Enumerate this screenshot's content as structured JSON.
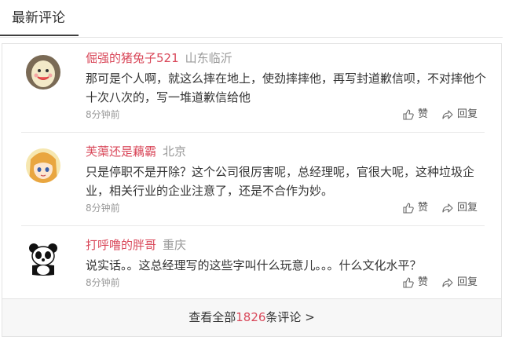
{
  "tabs": {
    "active_label": "最新评论"
  },
  "comments": [
    {
      "username": "倔强的猪兔子521",
      "location": "山东临沂",
      "text": "那可是个人啊，就这么摔在地上，使劲摔摔他，再写封道歉信呗，不对摔他个十次八次的，写一堆道歉信给他",
      "time": "8分钟前",
      "like_label": "赞",
      "reply_label": "回复",
      "avatar_icon": "smiley-egg-avatar"
    },
    {
      "username": "芙蕖还是藕霸",
      "location": "北京",
      "text": "只是停职不是开除？这个公司很厉害呢，总经理呢，官很大呢，这种垃圾企业，相关行业的企业注意了，还是不合作为妙。",
      "time": "8分钟前",
      "like_label": "赞",
      "reply_label": "回复",
      "avatar_icon": "anime-girl-avatar"
    },
    {
      "username": "打呼噜的胖哥",
      "location": "重庆",
      "text": "说实话。。这总经理写的这些字叫什么玩意儿。。。什么文化水平？",
      "time": "8分钟前",
      "like_label": "赞",
      "reply_label": "回复",
      "avatar_icon": "panda-avatar"
    }
  ],
  "footer": {
    "prefix": "查看全部",
    "count": "1826",
    "suffix": "条评论 >"
  },
  "colors": {
    "username": "#d9485a",
    "muted": "#999999",
    "border": "#e3e3e3"
  }
}
